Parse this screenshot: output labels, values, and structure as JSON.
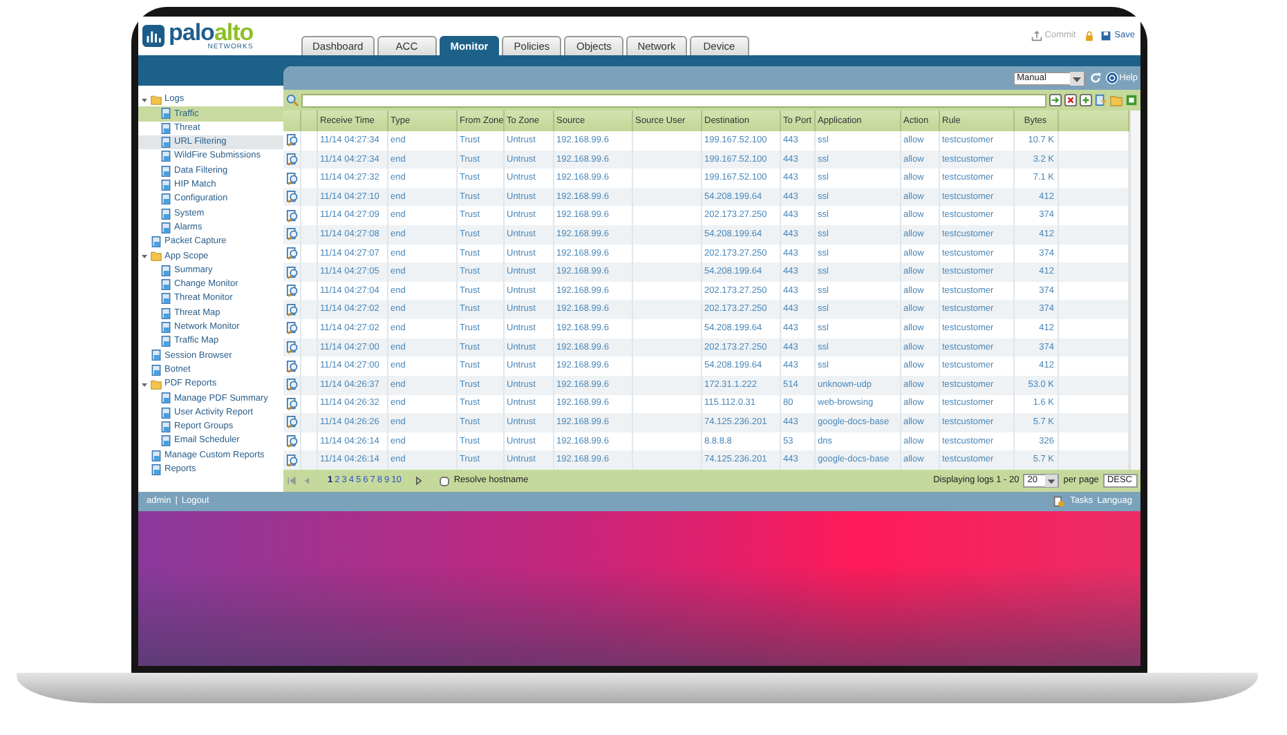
{
  "header": {
    "logo": {
      "first": "palo",
      "second": "alto",
      "tagline": "NETWORKS"
    },
    "tabs": [
      {
        "label": "Dashboard",
        "selected": false
      },
      {
        "label": "ACC",
        "selected": false
      },
      {
        "label": "Monitor",
        "selected": true
      },
      {
        "label": "Policies",
        "selected": false
      },
      {
        "label": "Objects",
        "selected": false
      },
      {
        "label": "Network",
        "selected": false
      },
      {
        "label": "Device",
        "selected": false
      }
    ],
    "actions": [
      {
        "kind": "commit",
        "label": "Commit",
        "disabled": true
      },
      {
        "kind": "save",
        "label": "Save",
        "disabled": false
      }
    ]
  },
  "toolbar": {
    "refresh_mode": "Manual",
    "help": "Help"
  },
  "sidebar": {
    "items": [
      {
        "label": "Logs",
        "selected": false,
        "expanded": true,
        "children": [
          {
            "label": "Traffic",
            "selected": true,
            "hovered": false
          },
          {
            "label": "Threat",
            "selected": false,
            "hovered": false
          },
          {
            "label": "URL Filtering",
            "selected": false,
            "hovered": true
          },
          {
            "label": "WildFire Submissions",
            "selected": false,
            "hovered": false
          },
          {
            "label": "Data Filtering",
            "selected": false,
            "hovered": false
          },
          {
            "label": "HIP Match",
            "selected": false,
            "hovered": false
          },
          {
            "label": "Configuration",
            "selected": false,
            "hovered": false
          },
          {
            "label": "System",
            "selected": false,
            "hovered": false
          },
          {
            "label": "Alarms",
            "selected": false,
            "hovered": false
          }
        ]
      },
      {
        "label": "Packet Capture",
        "selected": false
      },
      {
        "label": "App Scope",
        "selected": false,
        "expanded": true,
        "children": [
          {
            "label": "Summary",
            "selected": false
          },
          {
            "label": "Change Monitor",
            "selected": false
          },
          {
            "label": "Threat Monitor",
            "selected": false
          },
          {
            "label": "Threat Map",
            "selected": false
          },
          {
            "label": "Network Monitor",
            "selected": false
          },
          {
            "label": "Traffic Map",
            "selected": false
          }
        ]
      },
      {
        "label": "Session Browser",
        "selected": false
      },
      {
        "label": "Botnet",
        "selected": false
      },
      {
        "label": "PDF Reports",
        "selected": false,
        "expanded": true,
        "children": [
          {
            "label": "Manage PDF Summary",
            "selected": false
          },
          {
            "label": "User Activity Report",
            "selected": false
          },
          {
            "label": "Report Groups",
            "selected": false
          },
          {
            "label": "Email Scheduler",
            "selected": false
          }
        ]
      },
      {
        "label": "Manage Custom Reports",
        "selected": false
      },
      {
        "label": "Reports",
        "selected": false
      }
    ]
  },
  "table": {
    "columns": [
      "Receive Time",
      "Type",
      "From Zone",
      "To Zone",
      "Source",
      "Source User",
      "Destination",
      "To Port",
      "Application",
      "Action",
      "Rule",
      "Bytes"
    ],
    "rows": [
      {
        "receive_time": "11/14 04:27:34",
        "type": "end",
        "from_zone": "Trust",
        "to_zone": "Untrust",
        "source": "192.168.99.6",
        "destination": "199.167.52.100",
        "to_port": "443",
        "application": "ssl",
        "action": "allow",
        "rule": "testcustomer",
        "bytes": "10.7 K"
      },
      {
        "receive_time": "11/14 04:27:34",
        "type": "end",
        "from_zone": "Trust",
        "to_zone": "Untrust",
        "source": "192.168.99.6",
        "destination": "199.167.52.100",
        "to_port": "443",
        "application": "ssl",
        "action": "allow",
        "rule": "testcustomer",
        "bytes": "3.2 K"
      },
      {
        "receive_time": "11/14 04:27:32",
        "type": "end",
        "from_zone": "Trust",
        "to_zone": "Untrust",
        "source": "192.168.99.6",
        "destination": "199.167.52.100",
        "to_port": "443",
        "application": "ssl",
        "action": "allow",
        "rule": "testcustomer",
        "bytes": "7.1 K"
      },
      {
        "receive_time": "11/14 04:27:10",
        "type": "end",
        "from_zone": "Trust",
        "to_zone": "Untrust",
        "source": "192.168.99.6",
        "destination": "54.208.199.64",
        "to_port": "443",
        "application": "ssl",
        "action": "allow",
        "rule": "testcustomer",
        "bytes": "412"
      },
      {
        "receive_time": "11/14 04:27:09",
        "type": "end",
        "from_zone": "Trust",
        "to_zone": "Untrust",
        "source": "192.168.99.6",
        "destination": "202.173.27.250",
        "to_port": "443",
        "application": "ssl",
        "action": "allow",
        "rule": "testcustomer",
        "bytes": "374"
      },
      {
        "receive_time": "11/14 04:27:08",
        "type": "end",
        "from_zone": "Trust",
        "to_zone": "Untrust",
        "source": "192.168.99.6",
        "destination": "54.208.199.64",
        "to_port": "443",
        "application": "ssl",
        "action": "allow",
        "rule": "testcustomer",
        "bytes": "412"
      },
      {
        "receive_time": "11/14 04:27:07",
        "type": "end",
        "from_zone": "Trust",
        "to_zone": "Untrust",
        "source": "192.168.99.6",
        "destination": "202.173.27.250",
        "to_port": "443",
        "application": "ssl",
        "action": "allow",
        "rule": "testcustomer",
        "bytes": "374"
      },
      {
        "receive_time": "11/14 04:27:05",
        "type": "end",
        "from_zone": "Trust",
        "to_zone": "Untrust",
        "source": "192.168.99.6",
        "destination": "54.208.199.64",
        "to_port": "443",
        "application": "ssl",
        "action": "allow",
        "rule": "testcustomer",
        "bytes": "412"
      },
      {
        "receive_time": "11/14 04:27:04",
        "type": "end",
        "from_zone": "Trust",
        "to_zone": "Untrust",
        "source": "192.168.99.6",
        "destination": "202.173.27.250",
        "to_port": "443",
        "application": "ssl",
        "action": "allow",
        "rule": "testcustomer",
        "bytes": "374"
      },
      {
        "receive_time": "11/14 04:27:02",
        "type": "end",
        "from_zone": "Trust",
        "to_zone": "Untrust",
        "source": "192.168.99.6",
        "destination": "202.173.27.250",
        "to_port": "443",
        "application": "ssl",
        "action": "allow",
        "rule": "testcustomer",
        "bytes": "374"
      },
      {
        "receive_time": "11/14 04:27:02",
        "type": "end",
        "from_zone": "Trust",
        "to_zone": "Untrust",
        "source": "192.168.99.6",
        "destination": "54.208.199.64",
        "to_port": "443",
        "application": "ssl",
        "action": "allow",
        "rule": "testcustomer",
        "bytes": "412"
      },
      {
        "receive_time": "11/14 04:27:00",
        "type": "end",
        "from_zone": "Trust",
        "to_zone": "Untrust",
        "source": "192.168.99.6",
        "destination": "202.173.27.250",
        "to_port": "443",
        "application": "ssl",
        "action": "allow",
        "rule": "testcustomer",
        "bytes": "374"
      },
      {
        "receive_time": "11/14 04:27:00",
        "type": "end",
        "from_zone": "Trust",
        "to_zone": "Untrust",
        "source": "192.168.99.6",
        "destination": "54.208.199.64",
        "to_port": "443",
        "application": "ssl",
        "action": "allow",
        "rule": "testcustomer",
        "bytes": "412"
      },
      {
        "receive_time": "11/14 04:26:37",
        "type": "end",
        "from_zone": "Trust",
        "to_zone": "Untrust",
        "source": "192.168.99.6",
        "destination": "172.31.1.222",
        "to_port": "514",
        "application": "unknown-udp",
        "action": "allow",
        "rule": "testcustomer",
        "bytes": "53.0 K"
      },
      {
        "receive_time": "11/14 04:26:32",
        "type": "end",
        "from_zone": "Trust",
        "to_zone": "Untrust",
        "source": "192.168.99.6",
        "destination": "115.112.0.31",
        "to_port": "80",
        "application": "web-browsing",
        "action": "allow",
        "rule": "testcustomer",
        "bytes": "1.6 K"
      },
      {
        "receive_time": "11/14 04:26:26",
        "type": "end",
        "from_zone": "Trust",
        "to_zone": "Untrust",
        "source": "192.168.99.6",
        "destination": "74.125.236.201",
        "to_port": "443",
        "application": "google-docs-base",
        "action": "allow",
        "rule": "testcustomer",
        "bytes": "5.7 K"
      },
      {
        "receive_time": "11/14 04:26:14",
        "type": "end",
        "from_zone": "Trust",
        "to_zone": "Untrust",
        "source": "192.168.99.6",
        "destination": "8.8.8.8",
        "to_port": "53",
        "application": "dns",
        "action": "allow",
        "rule": "testcustomer",
        "bytes": "326"
      },
      {
        "receive_time": "11/14 04:26:14",
        "type": "end",
        "from_zone": "Trust",
        "to_zone": "Untrust",
        "source": "192.168.99.6",
        "destination": "74.125.236.201",
        "to_port": "443",
        "application": "google-docs-base",
        "action": "allow",
        "rule": "testcustomer",
        "bytes": "5.7 K"
      }
    ]
  },
  "pager": {
    "pages": [
      {
        "label": "1",
        "selected": true
      },
      {
        "label": "2",
        "selected": false
      },
      {
        "label": "3",
        "selected": false
      },
      {
        "label": "4",
        "selected": false
      },
      {
        "label": "5",
        "selected": false
      },
      {
        "label": "6",
        "selected": false
      },
      {
        "label": "7",
        "selected": false
      },
      {
        "label": "8",
        "selected": false
      },
      {
        "label": "9",
        "selected": false
      },
      {
        "label": "10",
        "selected": false
      }
    ],
    "resolve_hostname": {
      "label": "Resolve hostname",
      "checked": false
    },
    "summary": "Displaying logs 1 - 20",
    "page_size": "20",
    "per_page": "per page",
    "sort": "DESC"
  },
  "status_bar": {
    "user": "admin",
    "separator": "|",
    "logout": "Logout",
    "tasks": "Tasks",
    "language": "Languag"
  }
}
